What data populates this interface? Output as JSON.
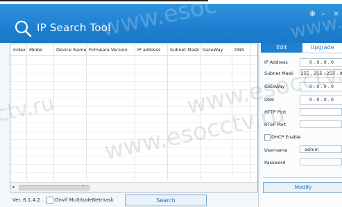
{
  "app": {
    "title": "IP Search Tool",
    "minimize_glyph": "–",
    "close_glyph": "×",
    "settings_glyph": "⊕"
  },
  "watermarks": [
    "www.esocctv.ru",
    "www.esoc",
    "ctv.ru",
    "www.esocctv.ru",
    "www."
  ],
  "table": {
    "columns": [
      "Index",
      "Model",
      "Device Name",
      "Firmware Version",
      "IP address",
      "Subnet Mask",
      "GateWay",
      "DNS"
    ],
    "rows": [],
    "scroll_left_glyph": "◂",
    "scroll_grip_glyph": "⁞"
  },
  "footer": {
    "version": "Ver. 6.1.4.2",
    "onvif_label": "Onvif MultitudeNetmask",
    "onvif_checked": false,
    "search_label": "Search"
  },
  "panel": {
    "tabs": {
      "edit": "Edit",
      "upgrade": "Upgrade",
      "active": "Edit"
    },
    "fields": {
      "ip_address": {
        "label": "IP Address",
        "value": "0 . 0 . 0 . 0"
      },
      "subnet_mask": {
        "label": "Subnet Mask",
        "value": "255 . 255 . 255 . 0"
      },
      "gateway": {
        "label": "GateWay",
        "value": "0 . 0 . 0 . 0"
      },
      "dns": {
        "label": "DNS",
        "value": "0 . 0 . 0 . 0"
      },
      "http_port": {
        "label": "HTTP Port",
        "value": ""
      },
      "rtsp_port": {
        "label": "RTSP Port",
        "value": ""
      },
      "username": {
        "label": "Username",
        "value": "admin"
      },
      "password": {
        "label": "Password",
        "value": ""
      }
    },
    "dhcp_label": "DHCP Enable",
    "dhcp_checked": false,
    "modify_label": "Modify"
  },
  "colors": {
    "header_blue": "#1e7fd0",
    "accent_blue": "#1f7fd1",
    "button_text": "#2a6fb6"
  }
}
